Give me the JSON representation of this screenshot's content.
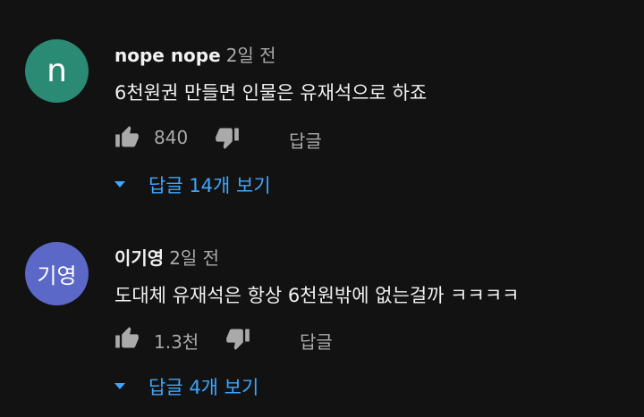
{
  "comments": [
    {
      "author": "nope nope",
      "time": "2일 전",
      "avatar_letter": "n",
      "avatar_color": "#2a8a73",
      "text": "6천원권 만들면 인물은 유재석으로 하죠",
      "likes": "840",
      "reply_label": "답글",
      "replies_label": "답글 14개 보기"
    },
    {
      "author": "이기영",
      "time": "2일 전",
      "avatar_letter": "기영",
      "avatar_color": "#5c68c8",
      "text": "도대체 유재석은 항상 6천원밖에 없는걸까 ㅋㅋㅋㅋ",
      "likes": "1.3천",
      "reply_label": "답글",
      "replies_label": "답글 4개 보기"
    }
  ],
  "colors": {
    "background": "#121212",
    "link": "#3ea6ff",
    "secondary_text": "#aaaaaa"
  },
  "icons": {
    "like": "thumbs-up-icon",
    "dislike": "thumbs-down-icon",
    "expand": "caret-down-icon"
  }
}
